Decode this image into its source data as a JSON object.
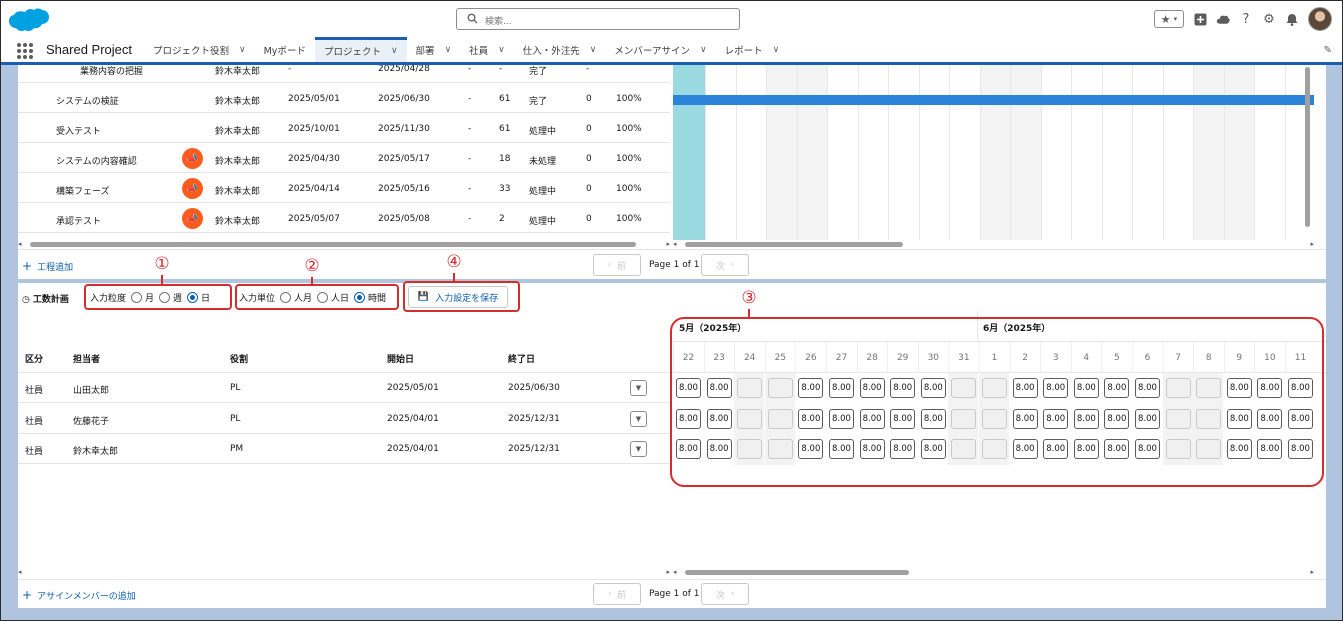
{
  "header": {
    "search_placeholder": "検索...",
    "icons": [
      "favorites-star-icon",
      "add-icon",
      "setup-assistant-icon",
      "help-icon",
      "settings-gear-icon",
      "notifications-bell-icon",
      "avatar"
    ]
  },
  "nav": {
    "app_name": "Shared Project",
    "items": [
      {
        "label": "プロジェクト役割",
        "has_menu": true
      },
      {
        "label": "Myボード",
        "has_menu": false
      },
      {
        "label": "プロジェクト",
        "has_menu": true,
        "active": true
      },
      {
        "label": "部署",
        "has_menu": true
      },
      {
        "label": "社員",
        "has_menu": true
      },
      {
        "label": "仕入・外注先",
        "has_menu": true
      },
      {
        "label": "メンバーアサイン",
        "has_menu": true
      },
      {
        "label": "レポート",
        "has_menu": true
      }
    ]
  },
  "tasks": {
    "rows": [
      {
        "name": "業務内容の把握",
        "owner": "鈴木幸太郎",
        "start": "-",
        "end": "2025/04/28",
        "c1": "-",
        "days": "-",
        "status": "完了",
        "c2": "-",
        "pct": "",
        "flag": false,
        "indent": true
      },
      {
        "name": "システムの検証",
        "owner": "鈴木幸太郎",
        "start": "2025/05/01",
        "end": "2025/06/30",
        "c1": "-",
        "days": "61",
        "status": "完了",
        "c2": "0",
        "pct": "100%",
        "flag": false
      },
      {
        "name": "受入テスト",
        "owner": "鈴木幸太郎",
        "start": "2025/10/01",
        "end": "2025/11/30",
        "c1": "-",
        "days": "61",
        "status": "処理中",
        "c2": "0",
        "pct": "100%",
        "flag": false
      },
      {
        "name": "システムの内容確認",
        "owner": "鈴木幸太郎",
        "start": "2025/04/30",
        "end": "2025/05/17",
        "c1": "-",
        "days": "18",
        "status": "未処理",
        "c2": "0",
        "pct": "100%",
        "flag": true
      },
      {
        "name": "構築フェーズ",
        "owner": "鈴木幸太郎",
        "start": "2025/04/14",
        "end": "2025/05/16",
        "c1": "-",
        "days": "33",
        "status": "処理中",
        "c2": "0",
        "pct": "100%",
        "flag": true
      },
      {
        "name": "承認テスト",
        "owner": "鈴木幸太郎",
        "start": "2025/05/07",
        "end": "2025/05/08",
        "c1": "-",
        "days": "2",
        "status": "処理中",
        "c2": "0",
        "pct": "100%",
        "flag": true
      }
    ],
    "add_label": "工程追加",
    "pager": {
      "prev": "前",
      "page": "Page 1 of 1",
      "next": "次"
    }
  },
  "workload": {
    "title": "工数計画",
    "granularity": {
      "label": "入力粒度",
      "options": [
        "月",
        "週",
        "日"
      ],
      "selected": "日"
    },
    "unit": {
      "label": "入力単位",
      "options": [
        "人月",
        "人日",
        "時間"
      ],
      "selected": "時間"
    },
    "save_label": "入力設定を保存",
    "callouts": [
      "①",
      "②",
      "③",
      "④"
    ],
    "columns": [
      "区分",
      "担当者",
      "役割",
      "開始日",
      "終了日"
    ],
    "members": [
      {
        "type": "社員",
        "name": "山田太郎",
        "role": "PL",
        "start": "2025/05/01",
        "end": "2025/06/30"
      },
      {
        "type": "社員",
        "name": "佐藤花子",
        "role": "PL",
        "start": "2025/04/01",
        "end": "2025/12/31"
      },
      {
        "type": "社員",
        "name": "鈴木幸太郎",
        "role": "PM",
        "start": "2025/04/01",
        "end": "2025/12/31"
      }
    ],
    "months": [
      "5月（2025年）",
      "6月（2025年）"
    ],
    "days": [
      "22",
      "23",
      "24",
      "25",
      "26",
      "27",
      "28",
      "29",
      "30",
      "31",
      "1",
      "2",
      "3",
      "4",
      "5",
      "6",
      "7",
      "8",
      "9",
      "10",
      "11"
    ],
    "weekend_days": [
      "24",
      "25",
      "31",
      "1",
      "7",
      "8"
    ],
    "cell_value": "8.00",
    "add_member_label": "アサインメンバーの追加",
    "pager": {
      "prev": "前",
      "page": "Page 1 of 1",
      "next": "次"
    }
  }
}
